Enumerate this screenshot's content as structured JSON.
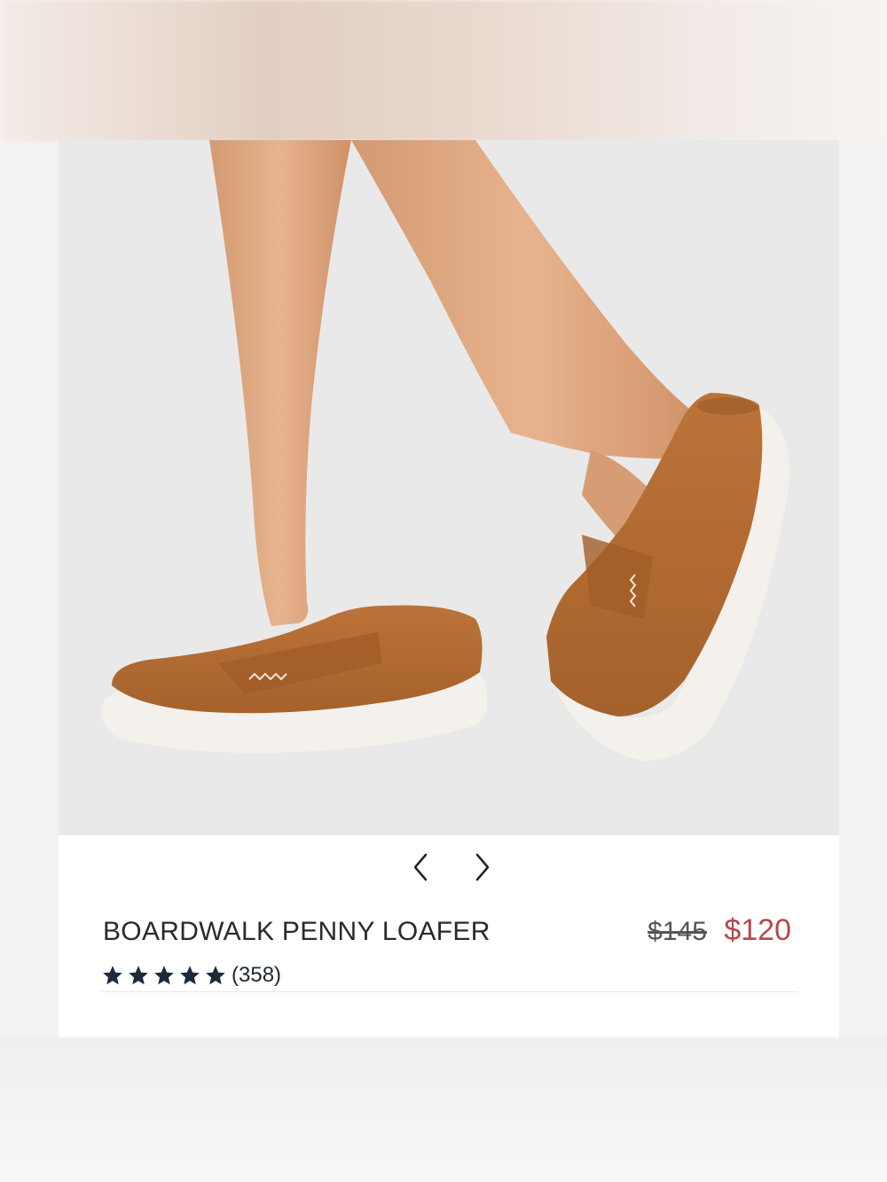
{
  "product": {
    "name": "BOARDWALK PENNY LOAFER",
    "original_price": "$145",
    "sale_price": "$120",
    "review_count": "(358)",
    "rating": 5,
    "rating_max": 5
  },
  "carousel": {
    "prev_icon": "chevron-left-icon",
    "next_icon": "chevron-right-icon"
  },
  "colors": {
    "sale_price": "#b5484a",
    "stars": "#1d2a3a",
    "shoe": "#b06a34",
    "sole": "#f4f1ec"
  }
}
